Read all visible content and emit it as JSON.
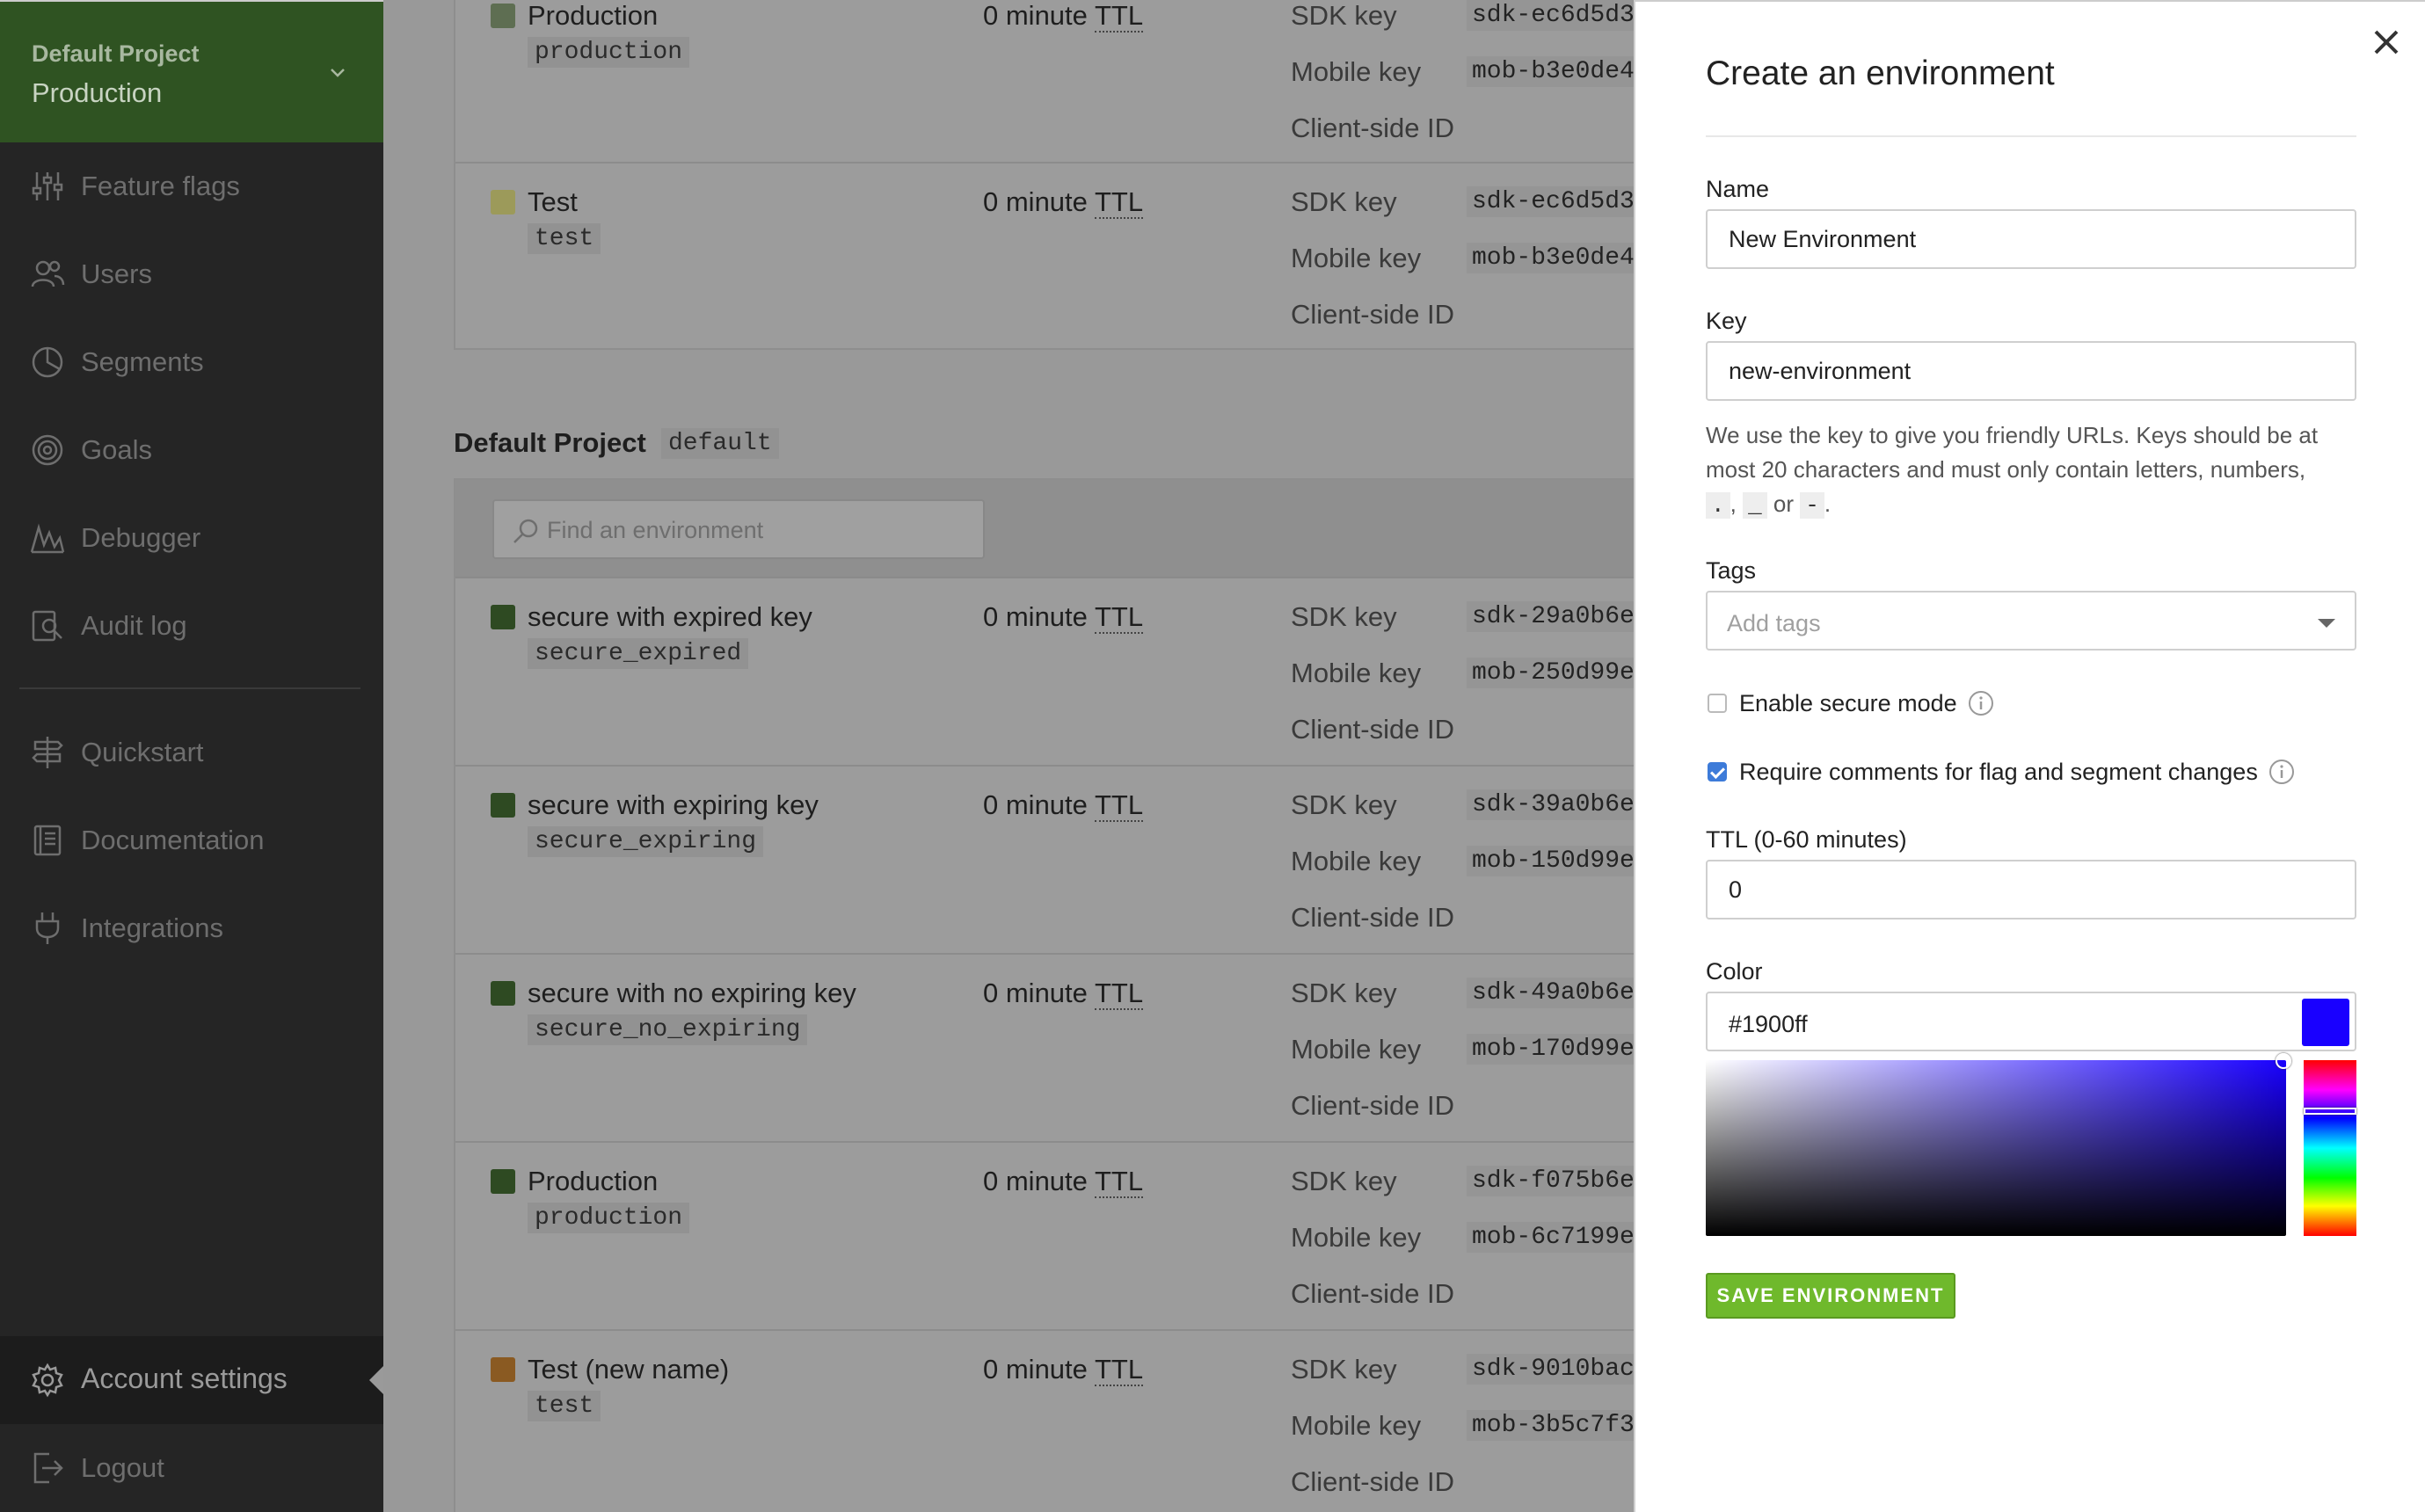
{
  "sidebar": {
    "project_name": "Default Project",
    "environment_name": "Production",
    "items": [
      {
        "label": "Feature flags",
        "icon": "sliders-icon"
      },
      {
        "label": "Users",
        "icon": "users-icon"
      },
      {
        "label": "Segments",
        "icon": "pie-chart-icon"
      },
      {
        "label": "Goals",
        "icon": "target-icon"
      },
      {
        "label": "Debugger",
        "icon": "debugger-icon"
      },
      {
        "label": "Audit log",
        "icon": "audit-log-icon"
      }
    ],
    "secondary_items": [
      {
        "label": "Quickstart",
        "icon": "signpost-icon"
      },
      {
        "label": "Documentation",
        "icon": "book-icon"
      },
      {
        "label": "Integrations",
        "icon": "plug-icon"
      }
    ],
    "account_settings": "Account settings",
    "logout": "Logout"
  },
  "main": {
    "top_card": {
      "environments": [
        {
          "name": "Production",
          "key": "production",
          "color": "#5e6e52",
          "ttl_prefix": "0 minute",
          "ttl_abbr": "TTL",
          "sdk_key": "sdk-ec6d5d3",
          "mobile_key": "mob-b3e0de4",
          "client_id": ""
        },
        {
          "name": "Test",
          "key": "test",
          "color": "#9c9a5a",
          "ttl_prefix": "0 minute",
          "ttl_abbr": "TTL",
          "sdk_key": "sdk-ec6d5d3",
          "mobile_key": "mob-b3e0de4",
          "client_id": ""
        }
      ]
    },
    "section_title": "Default Project",
    "section_key": "default",
    "search_placeholder": "Find an environment",
    "key_labels": {
      "sdk": "SDK key",
      "mobile": "Mobile key",
      "client": "Client-side ID"
    },
    "environments": [
      {
        "name": "secure with expired key",
        "key": "secure_expired",
        "color": "#2e4a22",
        "ttl_prefix": "0 minute",
        "ttl_abbr": "TTL",
        "sdk_key": "sdk-29a0b6e",
        "mobile_key": "mob-250d99e"
      },
      {
        "name": "secure with expiring key",
        "key": "secure_expiring",
        "color": "#2e4a22",
        "ttl_prefix": "0 minute",
        "ttl_abbr": "TTL",
        "sdk_key": "sdk-39a0b6e",
        "mobile_key": "mob-150d99e"
      },
      {
        "name": "secure with no expiring key",
        "key": "secure_no_expiring",
        "color": "#2e4a22",
        "ttl_prefix": "0 minute",
        "ttl_abbr": "TTL",
        "sdk_key": "sdk-49a0b6e",
        "mobile_key": "mob-170d99e"
      },
      {
        "name": "Production",
        "key": "production",
        "color": "#2e4a22",
        "ttl_prefix": "0 minute",
        "ttl_abbr": "TTL",
        "sdk_key": "sdk-f075b6e",
        "mobile_key": "mob-6c7199e"
      },
      {
        "name": "Test (new name)",
        "key": "test",
        "color": "#8a5a22",
        "ttl_prefix": "0 minute",
        "ttl_abbr": "TTL",
        "sdk_key": "sdk-9010bac",
        "mobile_key": "mob-3b5c7f3"
      }
    ]
  },
  "drawer": {
    "title": "Create an environment",
    "name_label": "Name",
    "name_value": "New Environment",
    "key_label": "Key",
    "key_value": "new-environment",
    "help_text_1": "We use the key to give you friendly URLs. Keys should be at most 20 characters and must only contain letters, numbers,",
    "help_chip_dot": ".",
    "help_comma": ",",
    "help_chip_underscore": "_",
    "help_or": "or",
    "help_chip_dash": "-",
    "help_end": ".",
    "tags_label": "Tags",
    "tags_placeholder": "Add tags",
    "secure_mode_label": "Enable secure mode",
    "secure_mode_checked": false,
    "require_comments_label": "Require comments for flag and segment changes",
    "require_comments_checked": true,
    "ttl_label": "TTL (0-60 minutes)",
    "ttl_value": "0",
    "color_label": "Color",
    "color_value": "#1900ff",
    "color_swatch": "#1900ff",
    "hue_level": 0.29,
    "save_label": "SAVE ENVIRONMENT",
    "accent_green": "#6fb92c"
  }
}
